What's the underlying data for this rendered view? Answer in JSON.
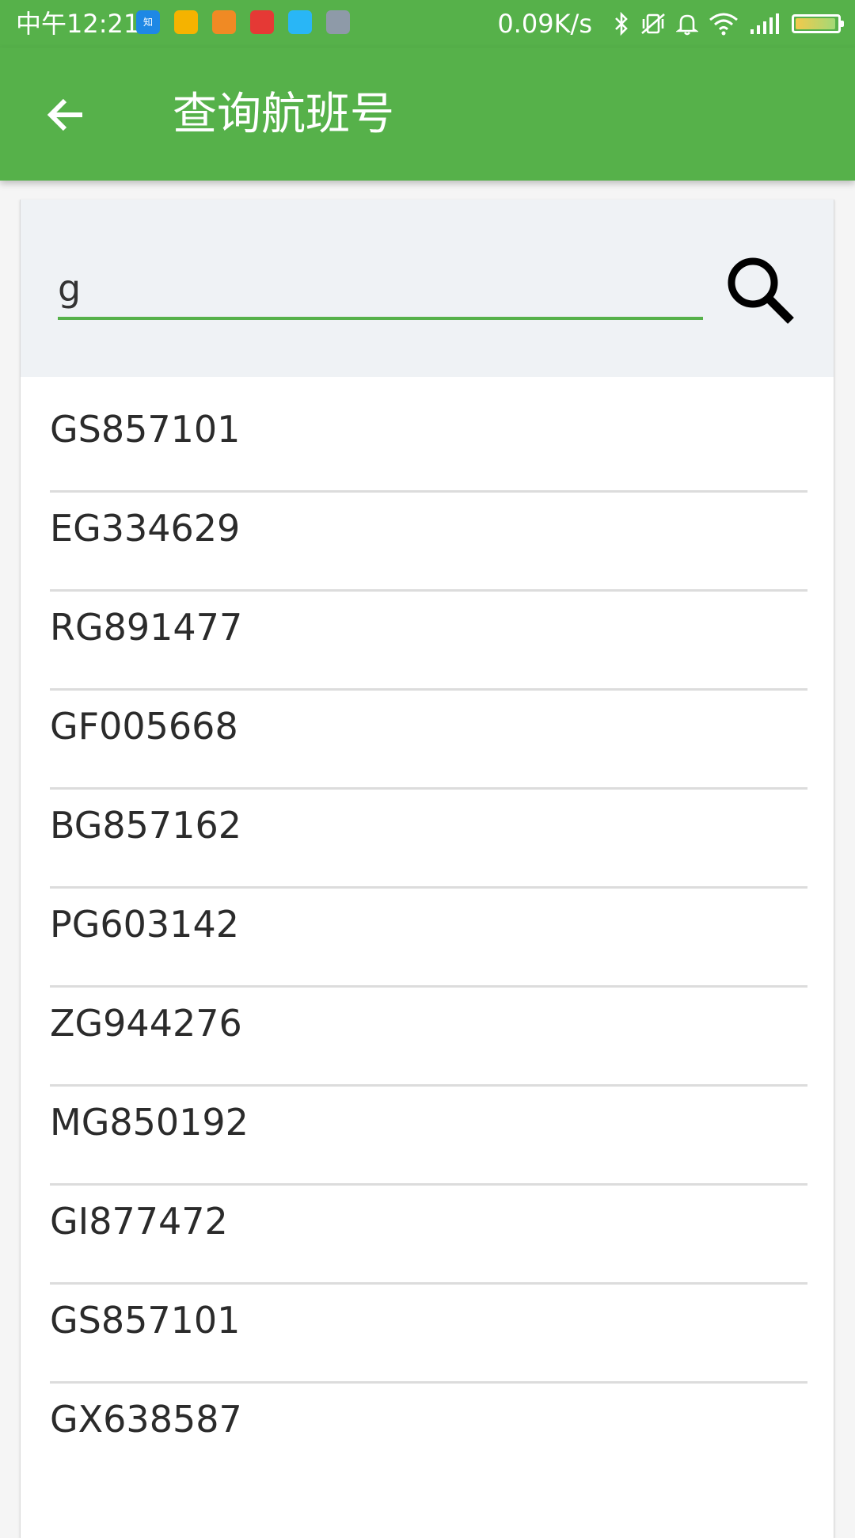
{
  "status_bar": {
    "time": "中午12:21",
    "network_speed": "0.09K/s",
    "app_icons": [
      {
        "name": "zhihu-app-icon",
        "label": "知",
        "color": "#1e88e5"
      },
      {
        "name": "yellow-app-icon",
        "label": "",
        "color": "#f5b300"
      },
      {
        "name": "orange-app-icon",
        "label": "",
        "color": "#f08a24"
      },
      {
        "name": "weibo-app-icon",
        "label": "",
        "color": "#e53935"
      },
      {
        "name": "blue-app-icon",
        "label": "",
        "color": "#29b6f6"
      },
      {
        "name": "gray-app-icon",
        "label": "",
        "color": "#8e9aa8"
      }
    ]
  },
  "app_bar": {
    "title": "查询航班号"
  },
  "search": {
    "value": "g"
  },
  "results": [
    "GS857101",
    "EG334629",
    "RG891477",
    "GF005668",
    "BG857162",
    "PG603142",
    "ZG944276",
    "MG850192",
    "GI877472",
    "GS857101",
    "GX638587"
  ],
  "colors": {
    "primary": "#56b14a",
    "search_background": "#eff2f5",
    "divider": "#dcdcdc"
  }
}
